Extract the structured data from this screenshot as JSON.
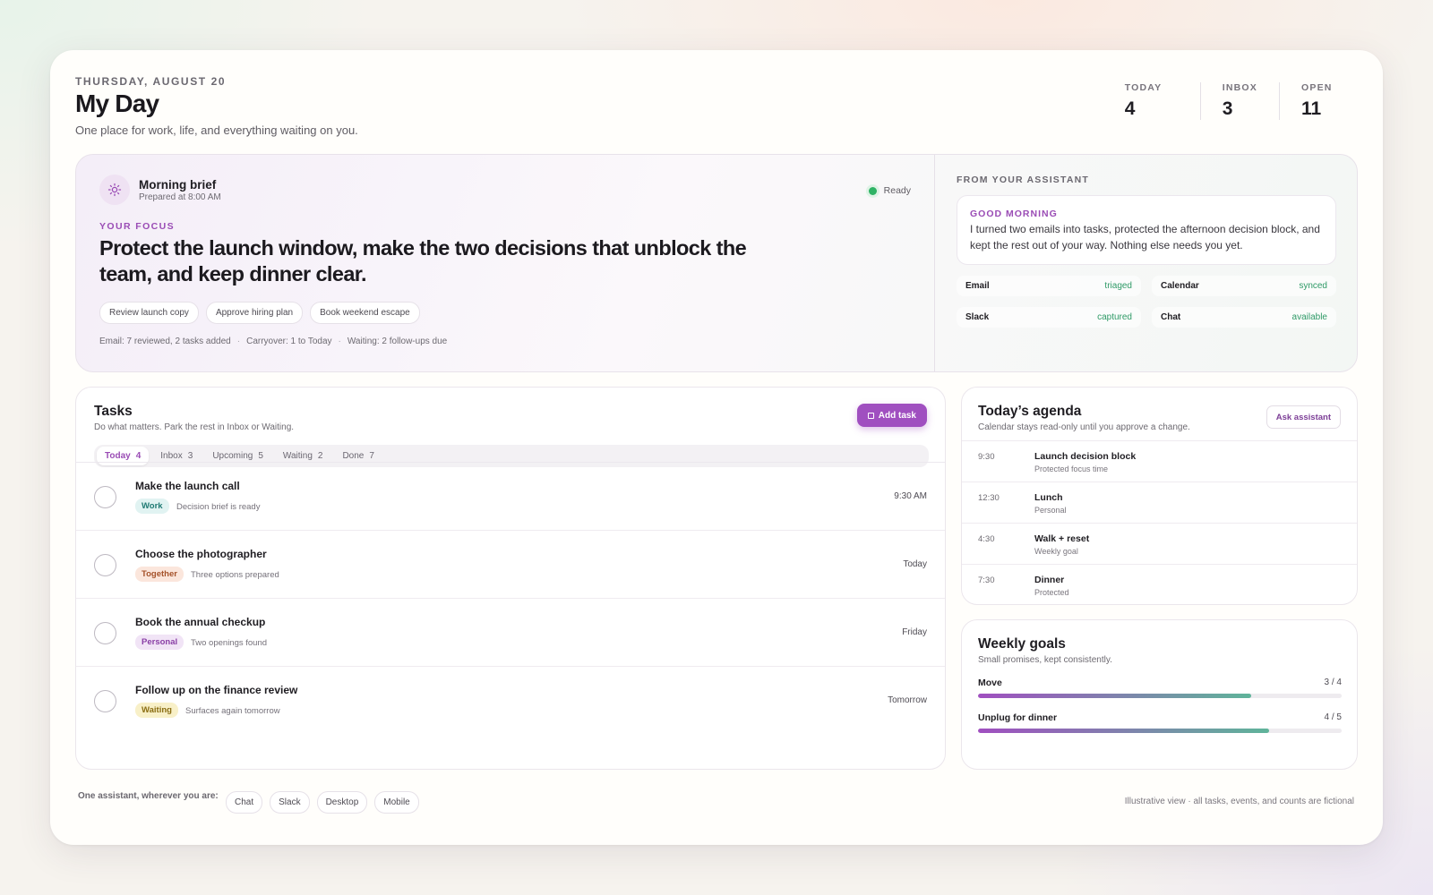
{
  "header": {
    "date": "THURSDAY, AUGUST 20",
    "title": "My Day",
    "subtitle": "One place for work, life, and everything waiting on you.",
    "stats": [
      {
        "label": "TODAY",
        "value": "4"
      },
      {
        "label": "INBOX",
        "value": "3"
      },
      {
        "label": "OPEN",
        "value": "11"
      }
    ]
  },
  "brief": {
    "icon": "sun-icon",
    "title": "Morning brief",
    "prepared": "Prepared at 8:00 AM",
    "status": "Ready",
    "status_color": "#2fb365",
    "focus_label": "YOUR FOCUS",
    "focus_text": "Protect the launch window, make the two decisions that unblock the team, and keep dinner clear.",
    "chips": [
      "Review launch copy",
      "Approve hiring plan",
      "Book weekend escape"
    ],
    "meta": [
      "Email: 7 reviewed, 2 tasks added",
      "Carryover: 1 to Today",
      "Waiting: 2 follow-ups due"
    ],
    "meta_separator": "·"
  },
  "assistant": {
    "label": "FROM YOUR ASSISTANT",
    "greeting": "GOOD MORNING",
    "message": "I turned two emails into tasks, protected the afternoon decision block, and kept the rest out of your way. Nothing else needs you yet.",
    "integrations": [
      {
        "name": "Email",
        "status": "triaged"
      },
      {
        "name": "Calendar",
        "status": "synced"
      },
      {
        "name": "Slack",
        "status": "captured"
      },
      {
        "name": "Chat",
        "status": "available"
      }
    ]
  },
  "tasks": {
    "title": "Tasks",
    "subtitle": "Do what matters. Park the rest in Inbox or Waiting.",
    "add_label": "Add task",
    "tabs": [
      {
        "label": "Today",
        "count": "4"
      },
      {
        "label": "Inbox",
        "count": "3"
      },
      {
        "label": "Upcoming",
        "count": "5"
      },
      {
        "label": "Waiting",
        "count": "2"
      },
      {
        "label": "Done",
        "count": "7"
      }
    ],
    "items": [
      {
        "name": "Make the launch call",
        "tag": "Work",
        "note": "Decision brief is ready",
        "when": "9:30 AM"
      },
      {
        "name": "Choose the photographer",
        "tag": "Together",
        "note": "Three options prepared",
        "when": "Today"
      },
      {
        "name": "Book the annual checkup",
        "tag": "Personal",
        "note": "Two openings found",
        "when": "Friday"
      },
      {
        "name": "Follow up on the finance review",
        "tag": "Waiting",
        "note": "Surfaces again tomorrow",
        "when": "Tomorrow"
      }
    ],
    "tag_colors": {
      "Work": {
        "bg": "#e1f3f2",
        "fg": "#1f7a73"
      },
      "Together": {
        "bg": "#fbe6dc",
        "fg": "#a5522a"
      },
      "Personal": {
        "bg": "#f1e4f6",
        "fg": "#8a3fa6"
      },
      "Waiting": {
        "bg": "#f8f0c8",
        "fg": "#8a6d12"
      }
    }
  },
  "agenda": {
    "title": "Today’s agenda",
    "subtitle": "Calendar stays read-only until you approve a change.",
    "ask_label": "Ask assistant",
    "events": [
      {
        "time": "9:30",
        "title": "Launch decision block",
        "sub": "Protected focus time"
      },
      {
        "time": "12:30",
        "title": "Lunch",
        "sub": "Personal"
      },
      {
        "time": "4:30",
        "title": "Walk + reset",
        "sub": "Weekly goal"
      },
      {
        "time": "7:30",
        "title": "Dinner",
        "sub": "Protected"
      }
    ]
  },
  "goals": {
    "title": "Weekly goals",
    "subtitle": "Small promises, kept consistently.",
    "items": [
      {
        "name": "Move",
        "count": "3 / 4",
        "progress": 0.75
      },
      {
        "name": "Unplug for dinner",
        "count": "4 / 5",
        "progress": 0.8
      }
    ]
  },
  "footer": {
    "label": "One assistant, wherever you are:",
    "channels": [
      "Chat",
      "Slack",
      "Desktop",
      "Mobile"
    ],
    "note": "Illustrative view · all tasks, events, and counts are fictional"
  },
  "colors": {
    "accent": "#a04fc0",
    "success": "#2f9a67"
  }
}
